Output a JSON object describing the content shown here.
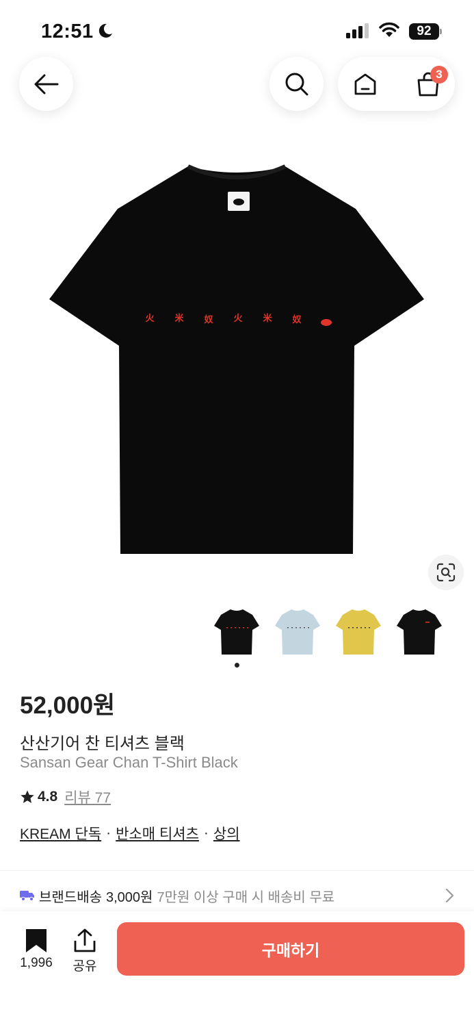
{
  "status_bar": {
    "time": "12:51",
    "battery": "92"
  },
  "nav": {
    "cart_badge": "3"
  },
  "product": {
    "price": "52,000원",
    "name_ko": "산산기어 찬 티셔츠 블랙",
    "name_en": "Sansan Gear Chan T-Shirt Black",
    "rating": "4.8",
    "review_link": "리뷰 77",
    "tags": [
      "KREAM 단독",
      "반소매 티셔츠",
      "상의"
    ],
    "tag_separator": "·",
    "print_glyphs": [
      "火",
      "米",
      "奴",
      "火",
      "米",
      "奴"
    ]
  },
  "thumbnails": [
    {
      "color_name": "black",
      "color": "#111111"
    },
    {
      "color_name": "light-blue",
      "color": "#c3d6e0"
    },
    {
      "color_name": "yellow",
      "color": "#e0c64a"
    },
    {
      "color_name": "black-small-print",
      "color": "#111111"
    }
  ],
  "delivery": {
    "label": "브랜드배송",
    "fee": "3,000원",
    "note": "7만원 이상 구매 시 배송비 무료"
  },
  "bottom_bar": {
    "bookmark_count": "1,996",
    "share_label": "공유",
    "buy_label": "구매하기"
  },
  "colors": {
    "accent": "#ef6253",
    "delivery_icon": "#6f6cf0"
  }
}
